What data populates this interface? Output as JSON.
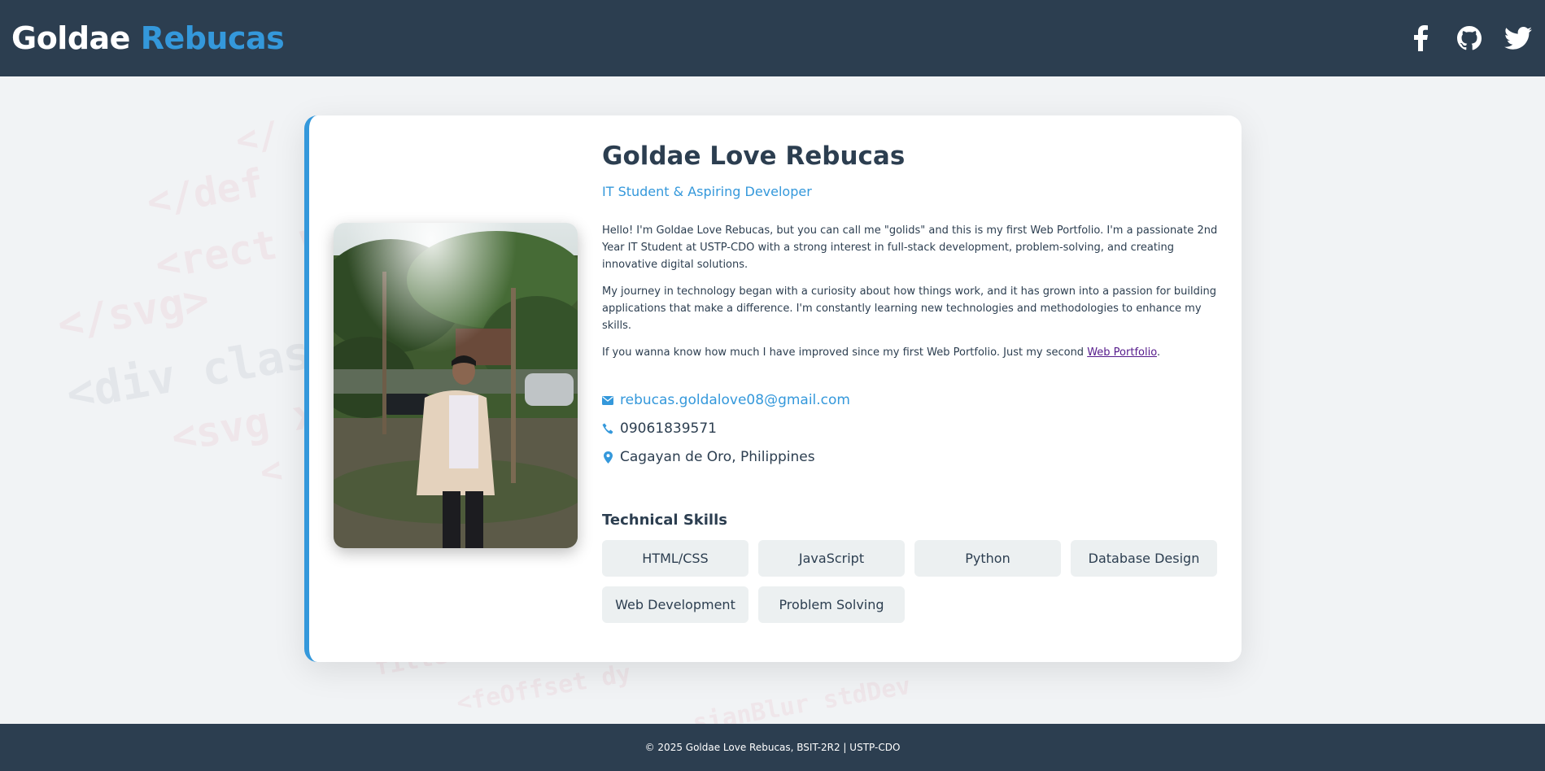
{
  "header": {
    "brand_first": "Goldae",
    "brand_second": "Rebucas",
    "socials": [
      {
        "icon": "facebook-icon"
      },
      {
        "icon": "github-icon"
      },
      {
        "icon": "twitter-icon"
      }
    ]
  },
  "profile": {
    "name": "Goldae Love Rebucas",
    "role": "IT Student & Aspiring Developer",
    "bio": {
      "p1": "Hello! I'm Goldae Love Rebucas, but you can call me \"golids\" and this is my first Web Portfolio. I'm a passionate 2nd Year IT Student at USTP-CDO with a strong interest in full-stack development, problem-solving, and creating innovative digital solutions.",
      "p2": "My journey in technology began with a curiosity about how things work, and it has grown into a passion for building applications that make a difference. I'm constantly learning new technologies and methodologies to enhance my skills.",
      "p3_text": "If you wanna know how much I have improved since my first Web Portfolio. Just my second ",
      "p3_link": "Web Portfolio",
      "p3_end": "."
    },
    "contacts": {
      "email": "rebucas.goldalove08@gmail.com",
      "phone": "09061839571",
      "location": "Cagayan de Oro, Philippines"
    },
    "skills_title": "Technical Skills",
    "skills": [
      "HTML/CSS",
      "JavaScript",
      "Python",
      "Database Design",
      "Web Development",
      "Problem Solving"
    ]
  },
  "footer": {
    "text": "© 2025 Goldae Love Rebucas, BSIT-2R2 | USTP-CDO"
  },
  "colors": {
    "header_bg": "#2c3e50",
    "accent": "#3498db",
    "chip_bg": "#ecf0f1",
    "text": "#2c3e50"
  }
}
